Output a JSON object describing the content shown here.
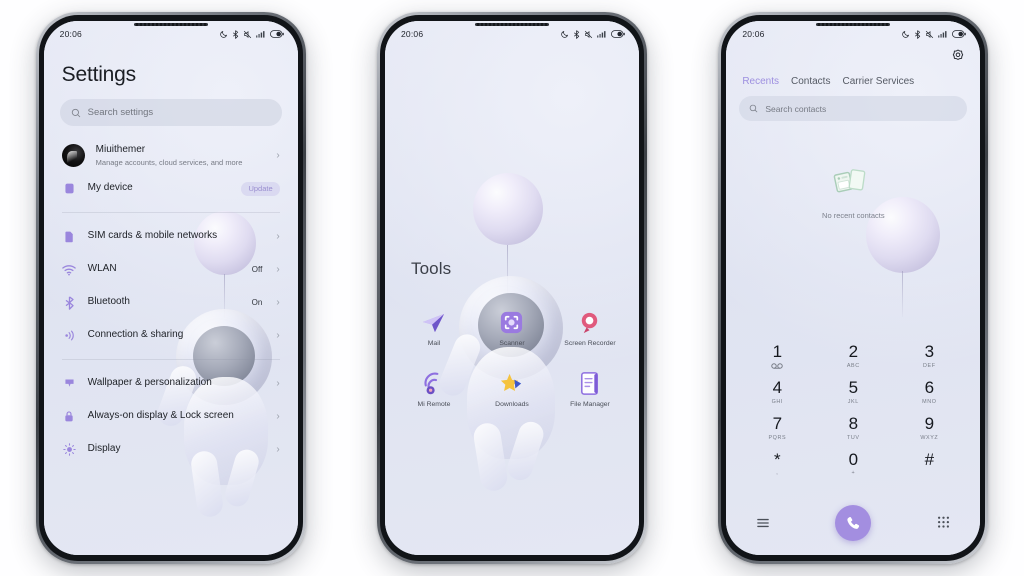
{
  "status_bar": {
    "time": "20:06",
    "icons": [
      "dnd-moon-icon",
      "bluetooth-icon",
      "mute-icon",
      "signal-icon",
      "battery-icon"
    ]
  },
  "phone_settings": {
    "title": "Settings",
    "search": {
      "placeholder": "Search settings",
      "icon": "search-icon"
    },
    "account": {
      "name": "Miuithemer",
      "subtitle": "Manage accounts, cloud services, and more",
      "avatar": "user-avatar"
    },
    "rows": [
      {
        "label": "My device",
        "icon": "device-icon",
        "badge": "Update",
        "value": ""
      },
      {
        "label": "SIM cards & mobile networks",
        "icon": "sim-icon",
        "value": ""
      },
      {
        "label": "WLAN",
        "icon": "wifi-icon",
        "value": "Off"
      },
      {
        "label": "Bluetooth",
        "icon": "bluetooth-icon",
        "value": "On"
      },
      {
        "label": "Connection & sharing",
        "icon": "connection-icon",
        "value": ""
      },
      {
        "label": "Wallpaper & personalization",
        "icon": "wallpaper-icon",
        "value": ""
      },
      {
        "label": "Always-on display & Lock screen",
        "icon": "lock-icon",
        "value": ""
      },
      {
        "label": "Display",
        "icon": "display-icon",
        "value": ""
      }
    ]
  },
  "phone_folder": {
    "title": "Tools",
    "apps": [
      {
        "label": "Mail",
        "icon": "mail-icon"
      },
      {
        "label": "Scanner",
        "icon": "scanner-icon"
      },
      {
        "label": "Screen Recorder",
        "icon": "screen-recorder-icon"
      },
      {
        "label": "Mi Remote",
        "icon": "mi-remote-icon"
      },
      {
        "label": "Downloads",
        "icon": "downloads-icon"
      },
      {
        "label": "File Manager",
        "icon": "file-manager-icon"
      }
    ]
  },
  "phone_dialer": {
    "settings_icon": "gear-icon",
    "tabs": [
      {
        "label": "Recents",
        "active": true
      },
      {
        "label": "Contacts",
        "active": false
      },
      {
        "label": "Carrier Services",
        "active": false
      }
    ],
    "search": {
      "placeholder": "Search contacts",
      "icon": "search-icon"
    },
    "empty_state": {
      "text": "No recent contacts",
      "icon": "no-contacts-icon"
    },
    "keypad": [
      {
        "num": "1",
        "sub": ""
      },
      {
        "num": "2",
        "sub": "ABC"
      },
      {
        "num": "3",
        "sub": "DEF"
      },
      {
        "num": "4",
        "sub": "GHI"
      },
      {
        "num": "5",
        "sub": "JKL"
      },
      {
        "num": "6",
        "sub": "MNO"
      },
      {
        "num": "7",
        "sub": "PQRS"
      },
      {
        "num": "8",
        "sub": "TUV"
      },
      {
        "num": "9",
        "sub": "WXYZ"
      },
      {
        "num": "*",
        "sub": ","
      },
      {
        "num": "0",
        "sub": "+"
      },
      {
        "num": "#",
        "sub": ""
      }
    ],
    "bottom": {
      "menu_icon": "menu-icon",
      "call_icon": "call-icon",
      "keypad_icon": "keypad-icon"
    }
  },
  "colors": {
    "accent": "#a38ee0",
    "screen_bg": "#e2e6f3",
    "text": "#1d2026",
    "frame": "#3c4046"
  }
}
